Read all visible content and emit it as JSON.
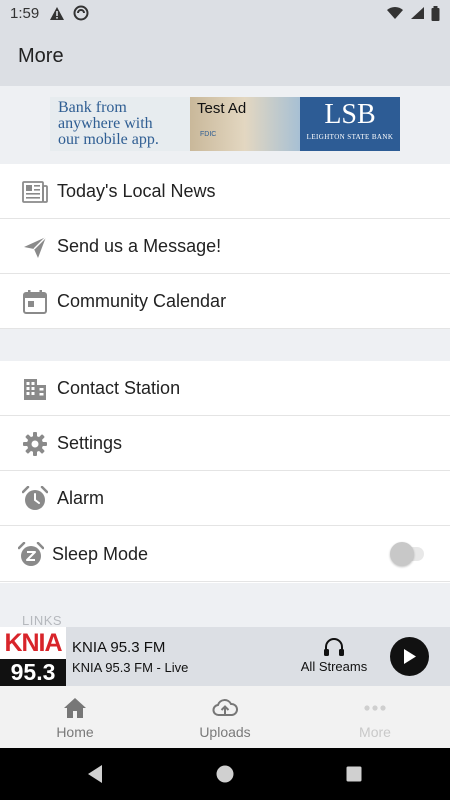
{
  "status_bar": {
    "time": "1:59",
    "left_icons": [
      "warning-icon",
      "sync-icon"
    ],
    "right_icons": [
      "wifi-icon",
      "signal-icon",
      "battery-icon"
    ]
  },
  "header": {
    "title": "More"
  },
  "ad": {
    "slogan_lines": [
      "Bank from",
      "anywhere with",
      "our mobile app."
    ],
    "test_label": "Test Ad",
    "logo_text": "LSB",
    "bank_name": "LEIGHTON STATE BANK",
    "fdic": "FDIC"
  },
  "menu_primary": [
    {
      "label": "Today's Local News",
      "icon": "newspaper-icon"
    },
    {
      "label": "Send us a Message!",
      "icon": "send-icon"
    },
    {
      "label": "Community Calendar",
      "icon": "calendar-icon"
    }
  ],
  "menu_secondary": [
    {
      "label": "Contact Station",
      "icon": "building-icon"
    },
    {
      "label": "Settings",
      "icon": "gear-icon"
    },
    {
      "label": "Alarm",
      "icon": "alarm-clock-icon"
    },
    {
      "label": "Sleep Mode",
      "icon": "sleep-clock-icon",
      "toggle_on": false
    }
  ],
  "links_label": "LINKS",
  "player": {
    "logo_top": "KNIA",
    "logo_bottom": "95.3",
    "station_name": "KNIA 95.3 FM",
    "station_sub": "KNIA 95.3 FM - Live",
    "streams_label": "All Streams",
    "streams_icon": "headphones-icon",
    "play_icon": "play-icon"
  },
  "tabs": [
    {
      "label": "Home",
      "icon": "home-icon",
      "active": false
    },
    {
      "label": "Uploads",
      "icon": "cloud-upload-icon",
      "active": false
    },
    {
      "label": "More",
      "icon": "more-dots-icon",
      "active": true
    }
  ],
  "nav": [
    "back-icon",
    "home-circle-icon",
    "recents-icon"
  ],
  "colors": {
    "header_bg": "#dcdfe4",
    "gap_bg": "#eef0f3",
    "icon_gray": "#8a8a8a",
    "logo_red": "#d8242a",
    "ad_blue": "#2d5c95"
  }
}
